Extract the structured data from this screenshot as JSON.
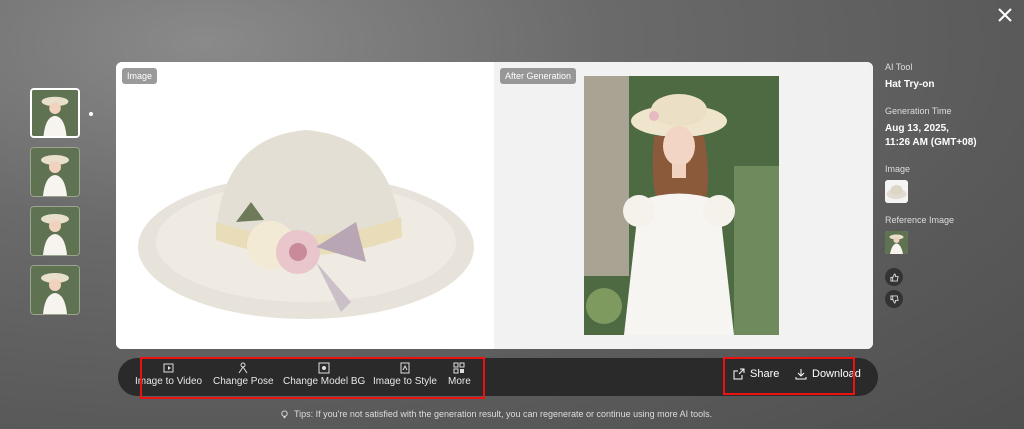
{
  "viewer": {
    "left_label": "Image",
    "right_label": "After Generation"
  },
  "toolbar": {
    "tools": [
      {
        "label": "Image to Video",
        "icon": "video-icon"
      },
      {
        "label": "Change Pose",
        "icon": "pose-icon"
      },
      {
        "label": "Change Model BG",
        "icon": "background-icon"
      },
      {
        "label": "Image to Style",
        "icon": "style-icon"
      },
      {
        "label": "More",
        "icon": "grid-icon"
      }
    ],
    "share_label": "Share",
    "download_label": "Download"
  },
  "tips": "Tips: If you're not satisfied with the generation result, you can regenerate or continue using more AI tools.",
  "info": {
    "ai_tool_label": "AI Tool",
    "ai_tool_value": "Hat Try-on",
    "gen_time_label": "Generation Time",
    "gen_time_value_1": "Aug 13, 2025,",
    "gen_time_value_2": "11:26 AM (GMT+08)",
    "image_label": "Image",
    "reference_label": "Reference Image"
  },
  "colors": {
    "highlight": "#e11111",
    "toolbar_bg": "#2a2a2a"
  }
}
